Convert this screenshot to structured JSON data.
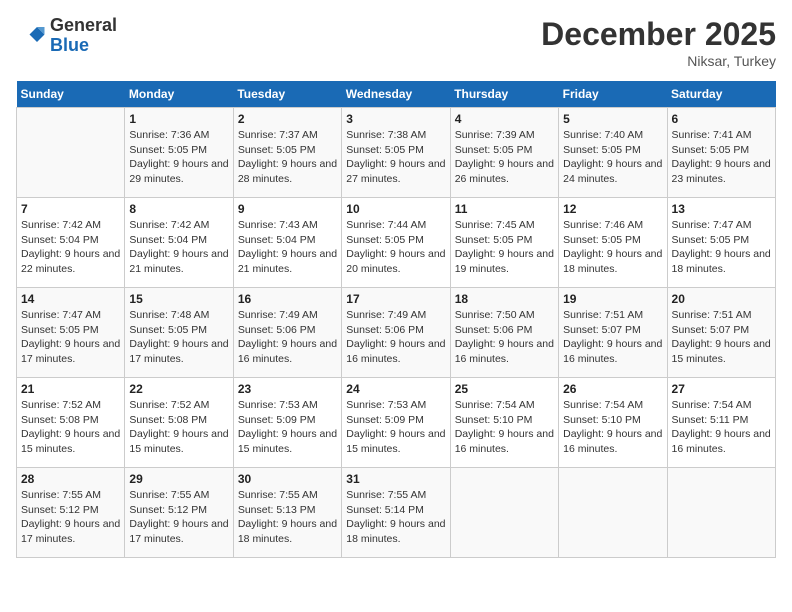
{
  "header": {
    "logo_general": "General",
    "logo_blue": "Blue",
    "month_year": "December 2025",
    "location": "Niksar, Turkey"
  },
  "days_of_week": [
    "Sunday",
    "Monday",
    "Tuesday",
    "Wednesday",
    "Thursday",
    "Friday",
    "Saturday"
  ],
  "weeks": [
    [
      {
        "day": "",
        "sunrise": "",
        "sunset": "",
        "daylight": ""
      },
      {
        "day": "1",
        "sunrise": "Sunrise: 7:36 AM",
        "sunset": "Sunset: 5:05 PM",
        "daylight": "Daylight: 9 hours and 29 minutes."
      },
      {
        "day": "2",
        "sunrise": "Sunrise: 7:37 AM",
        "sunset": "Sunset: 5:05 PM",
        "daylight": "Daylight: 9 hours and 28 minutes."
      },
      {
        "day": "3",
        "sunrise": "Sunrise: 7:38 AM",
        "sunset": "Sunset: 5:05 PM",
        "daylight": "Daylight: 9 hours and 27 minutes."
      },
      {
        "day": "4",
        "sunrise": "Sunrise: 7:39 AM",
        "sunset": "Sunset: 5:05 PM",
        "daylight": "Daylight: 9 hours and 26 minutes."
      },
      {
        "day": "5",
        "sunrise": "Sunrise: 7:40 AM",
        "sunset": "Sunset: 5:05 PM",
        "daylight": "Daylight: 9 hours and 24 minutes."
      },
      {
        "day": "6",
        "sunrise": "Sunrise: 7:41 AM",
        "sunset": "Sunset: 5:05 PM",
        "daylight": "Daylight: 9 hours and 23 minutes."
      }
    ],
    [
      {
        "day": "7",
        "sunrise": "Sunrise: 7:42 AM",
        "sunset": "Sunset: 5:04 PM",
        "daylight": "Daylight: 9 hours and 22 minutes."
      },
      {
        "day": "8",
        "sunrise": "Sunrise: 7:42 AM",
        "sunset": "Sunset: 5:04 PM",
        "daylight": "Daylight: 9 hours and 21 minutes."
      },
      {
        "day": "9",
        "sunrise": "Sunrise: 7:43 AM",
        "sunset": "Sunset: 5:04 PM",
        "daylight": "Daylight: 9 hours and 21 minutes."
      },
      {
        "day": "10",
        "sunrise": "Sunrise: 7:44 AM",
        "sunset": "Sunset: 5:05 PM",
        "daylight": "Daylight: 9 hours and 20 minutes."
      },
      {
        "day": "11",
        "sunrise": "Sunrise: 7:45 AM",
        "sunset": "Sunset: 5:05 PM",
        "daylight": "Daylight: 9 hours and 19 minutes."
      },
      {
        "day": "12",
        "sunrise": "Sunrise: 7:46 AM",
        "sunset": "Sunset: 5:05 PM",
        "daylight": "Daylight: 9 hours and 18 minutes."
      },
      {
        "day": "13",
        "sunrise": "Sunrise: 7:47 AM",
        "sunset": "Sunset: 5:05 PM",
        "daylight": "Daylight: 9 hours and 18 minutes."
      }
    ],
    [
      {
        "day": "14",
        "sunrise": "Sunrise: 7:47 AM",
        "sunset": "Sunset: 5:05 PM",
        "daylight": "Daylight: 9 hours and 17 minutes."
      },
      {
        "day": "15",
        "sunrise": "Sunrise: 7:48 AM",
        "sunset": "Sunset: 5:05 PM",
        "daylight": "Daylight: 9 hours and 17 minutes."
      },
      {
        "day": "16",
        "sunrise": "Sunrise: 7:49 AM",
        "sunset": "Sunset: 5:06 PM",
        "daylight": "Daylight: 9 hours and 16 minutes."
      },
      {
        "day": "17",
        "sunrise": "Sunrise: 7:49 AM",
        "sunset": "Sunset: 5:06 PM",
        "daylight": "Daylight: 9 hours and 16 minutes."
      },
      {
        "day": "18",
        "sunrise": "Sunrise: 7:50 AM",
        "sunset": "Sunset: 5:06 PM",
        "daylight": "Daylight: 9 hours and 16 minutes."
      },
      {
        "day": "19",
        "sunrise": "Sunrise: 7:51 AM",
        "sunset": "Sunset: 5:07 PM",
        "daylight": "Daylight: 9 hours and 16 minutes."
      },
      {
        "day": "20",
        "sunrise": "Sunrise: 7:51 AM",
        "sunset": "Sunset: 5:07 PM",
        "daylight": "Daylight: 9 hours and 15 minutes."
      }
    ],
    [
      {
        "day": "21",
        "sunrise": "Sunrise: 7:52 AM",
        "sunset": "Sunset: 5:08 PM",
        "daylight": "Daylight: 9 hours and 15 minutes."
      },
      {
        "day": "22",
        "sunrise": "Sunrise: 7:52 AM",
        "sunset": "Sunset: 5:08 PM",
        "daylight": "Daylight: 9 hours and 15 minutes."
      },
      {
        "day": "23",
        "sunrise": "Sunrise: 7:53 AM",
        "sunset": "Sunset: 5:09 PM",
        "daylight": "Daylight: 9 hours and 15 minutes."
      },
      {
        "day": "24",
        "sunrise": "Sunrise: 7:53 AM",
        "sunset": "Sunset: 5:09 PM",
        "daylight": "Daylight: 9 hours and 15 minutes."
      },
      {
        "day": "25",
        "sunrise": "Sunrise: 7:54 AM",
        "sunset": "Sunset: 5:10 PM",
        "daylight": "Daylight: 9 hours and 16 minutes."
      },
      {
        "day": "26",
        "sunrise": "Sunrise: 7:54 AM",
        "sunset": "Sunset: 5:10 PM",
        "daylight": "Daylight: 9 hours and 16 minutes."
      },
      {
        "day": "27",
        "sunrise": "Sunrise: 7:54 AM",
        "sunset": "Sunset: 5:11 PM",
        "daylight": "Daylight: 9 hours and 16 minutes."
      }
    ],
    [
      {
        "day": "28",
        "sunrise": "Sunrise: 7:55 AM",
        "sunset": "Sunset: 5:12 PM",
        "daylight": "Daylight: 9 hours and 17 minutes."
      },
      {
        "day": "29",
        "sunrise": "Sunrise: 7:55 AM",
        "sunset": "Sunset: 5:12 PM",
        "daylight": "Daylight: 9 hours and 17 minutes."
      },
      {
        "day": "30",
        "sunrise": "Sunrise: 7:55 AM",
        "sunset": "Sunset: 5:13 PM",
        "daylight": "Daylight: 9 hours and 18 minutes."
      },
      {
        "day": "31",
        "sunrise": "Sunrise: 7:55 AM",
        "sunset": "Sunset: 5:14 PM",
        "daylight": "Daylight: 9 hours and 18 minutes."
      },
      {
        "day": "",
        "sunrise": "",
        "sunset": "",
        "daylight": ""
      },
      {
        "day": "",
        "sunrise": "",
        "sunset": "",
        "daylight": ""
      },
      {
        "day": "",
        "sunrise": "",
        "sunset": "",
        "daylight": ""
      }
    ]
  ]
}
